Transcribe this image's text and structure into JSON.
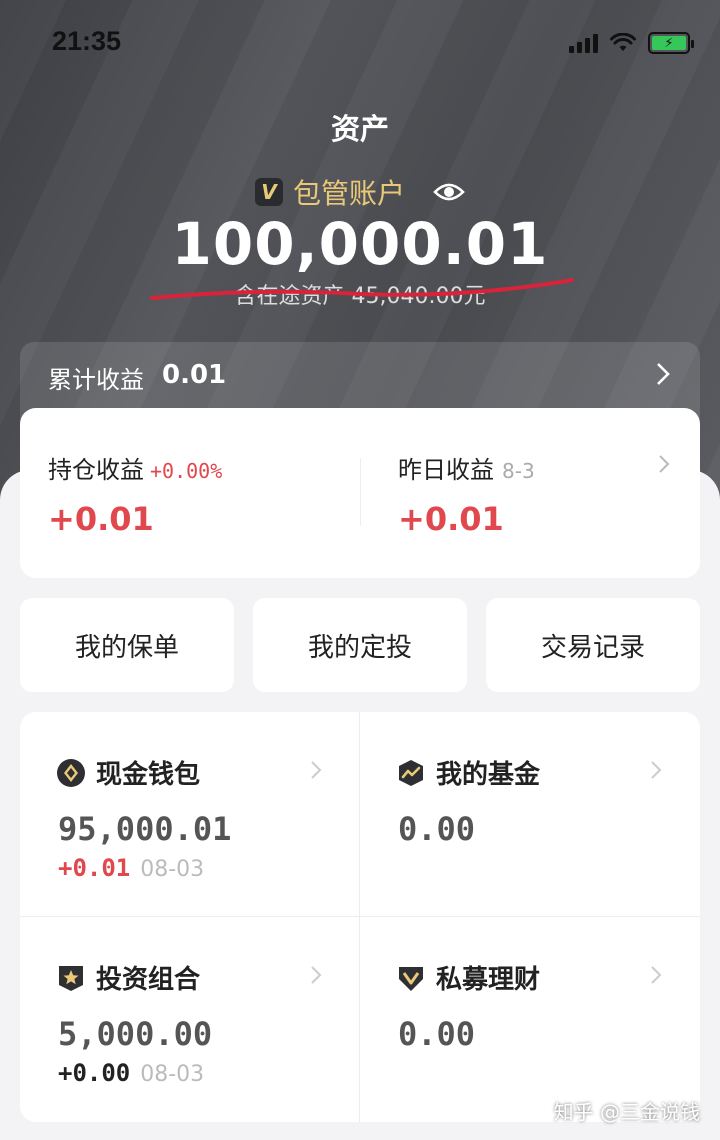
{
  "status_bar": {
    "time": "21:35"
  },
  "header": {
    "title": "资产",
    "account_badge": "V",
    "account_name": "包管账户",
    "total": "100,000.01",
    "transit_note": "含在途资产 45,040.00元"
  },
  "cumulative": {
    "label": "累计收益",
    "value": "0.01"
  },
  "holding": {
    "left_label": "持仓收益",
    "left_pct": "+0.00%",
    "left_value": "+0.01",
    "right_label": "昨日收益",
    "right_date": "8-3",
    "right_value": "+0.01"
  },
  "quick_actions": [
    {
      "label": "我的保单"
    },
    {
      "label": "我的定投"
    },
    {
      "label": "交易记录"
    }
  ],
  "products": [
    {
      "title": "现金钱包",
      "icon": "diamond-coin-icon",
      "value": "95,000.01",
      "change": "+0.01",
      "change_color": "#e0484d",
      "date": "08-03"
    },
    {
      "title": "我的基金",
      "icon": "chart-trend-icon",
      "value": "0.00"
    },
    {
      "title": "投资组合",
      "icon": "star-shield-icon",
      "value": "5,000.00",
      "change": "+0.00",
      "change_color": "#222222",
      "date": "08-03"
    },
    {
      "title": "私募理财",
      "icon": "v-gem-icon",
      "value": "0.00"
    }
  ],
  "watermark": "知乎 @三金说钱",
  "colors": {
    "gain_red": "#e0484d",
    "gold": "#e9c878"
  }
}
